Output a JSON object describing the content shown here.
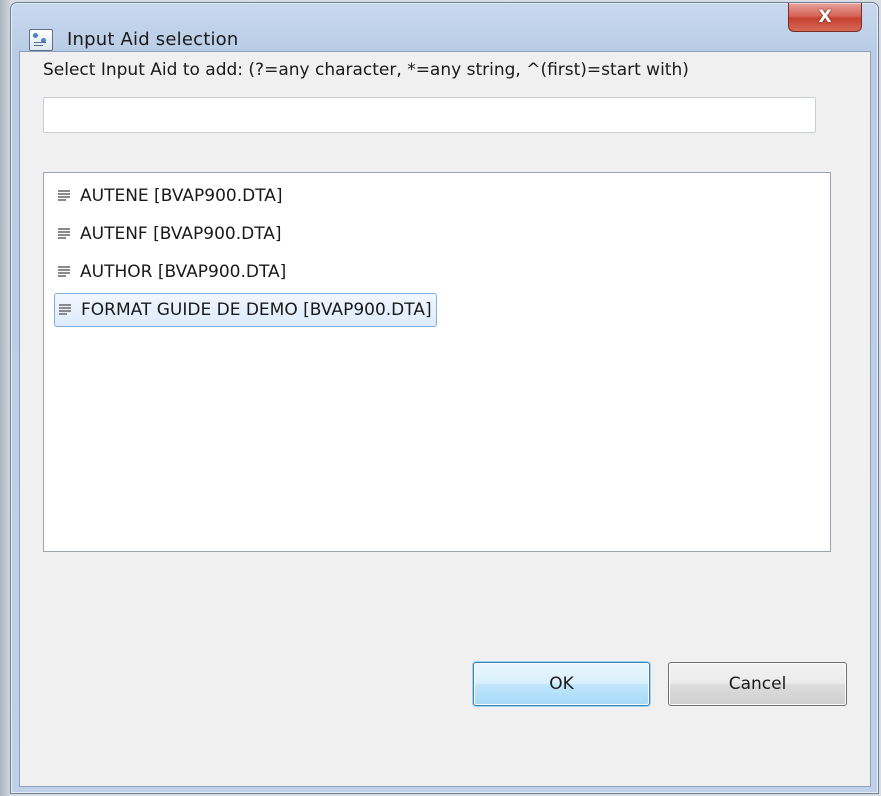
{
  "window": {
    "title": "Input Aid selection",
    "close_label": "X"
  },
  "prompt": {
    "label": "Select Input Aid to add: (?=any character, *=any string, ^(first)=start with)"
  },
  "filter": {
    "value": "",
    "placeholder": ""
  },
  "list": {
    "items": [
      {
        "label": "AUTENE  [BVAP900.DTA]",
        "selected": false
      },
      {
        "label": "AUTENF  [BVAP900.DTA]",
        "selected": false
      },
      {
        "label": "AUTHOR  [BVAP900.DTA]",
        "selected": false
      },
      {
        "label": "FORMAT GUIDE DE DEMO  [BVAP900.DTA]",
        "selected": true
      }
    ]
  },
  "buttons": {
    "ok_label": "OK",
    "cancel_label": "Cancel"
  },
  "colors": {
    "selection_border": "#84acdd",
    "ok_border": "#3c7fb1",
    "close_red": "#c7402f"
  }
}
